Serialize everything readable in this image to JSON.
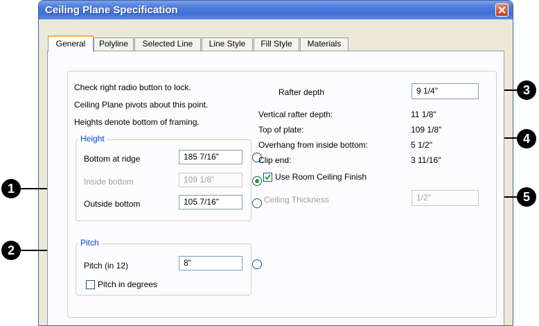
{
  "window": {
    "title": "Ceiling Plane Specification"
  },
  "tabs": [
    {
      "label": "General",
      "active": true
    },
    {
      "label": "Polyline"
    },
    {
      "label": "Selected Line"
    },
    {
      "label": "Line Style"
    },
    {
      "label": "Fill Style"
    },
    {
      "label": "Materials"
    }
  ],
  "info": [
    "Check right radio button to lock.",
    "Ceiling Plane pivots about this point.",
    "Heights denote bottom of framing."
  ],
  "height": {
    "legend": "Height",
    "bottom_at_ridge": {
      "label": "Bottom at ridge",
      "value": "185 7/16\""
    },
    "inside_bottom": {
      "label": "Inside bottom",
      "value": "109 1/8\"",
      "locked": true
    },
    "outside_bottom": {
      "label": "Outside bottom",
      "value": "105 7/16\""
    }
  },
  "pitch": {
    "legend": "Pitch",
    "pitch_in_12": {
      "label": "Pitch (in 12)",
      "value": "8\""
    },
    "pitch_in_degrees": {
      "label": "Pitch in degrees",
      "checked": false
    }
  },
  "rafter": {
    "rafter_depth": {
      "label": "Rafter depth",
      "value": "9 1/4\""
    },
    "vertical_rafter_depth": {
      "label": "Vertical rafter depth:",
      "value": "11 1/8\""
    },
    "top_of_plate": {
      "label": "Top of plate:",
      "value": "109 1/8\""
    },
    "overhang": {
      "label": "Overhang from inside bottom:",
      "value": "5 1/2\""
    },
    "clip_end": {
      "label": "Clip end:",
      "value": "3 11/16\""
    }
  },
  "ceiling": {
    "use_room_finish": {
      "label": "Use Room Ceiling Finish",
      "checked": true
    },
    "thickness": {
      "label": "Ceiling Thickness",
      "value": "1/2\""
    }
  },
  "callouts": [
    "1",
    "2",
    "3",
    "4",
    "5"
  ],
  "icons": {
    "close": "close-icon",
    "check": "check-icon"
  }
}
